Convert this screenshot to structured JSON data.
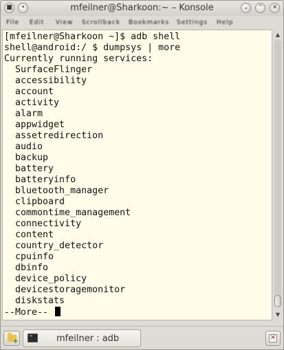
{
  "window": {
    "title": "mfeilner@Sharkoon:~ – Konsole"
  },
  "menubar": {
    "items": [
      "File",
      "Edit",
      "View",
      "Scrollback",
      "Bookmarks",
      "Settings",
      "Help"
    ]
  },
  "terminal": {
    "lines": [
      "[mfeilner@Sharkoon ~]$ adb shell",
      "shell@android:/ $ dumpsys | more",
      "Currently running services:",
      "  SurfaceFlinger",
      "  accessibility",
      "  account",
      "  activity",
      "  alarm",
      "  appwidget",
      "  assetredirection",
      "  audio",
      "  backup",
      "  battery",
      "  batteryinfo",
      "  bluetooth_manager",
      "  clipboard",
      "  commontime_management",
      "  connectivity",
      "  content",
      "  country_detector",
      "  cpuinfo",
      "  dbinfo",
      "  device_policy",
      "  devicestoragemonitor",
      "  diskstats"
    ],
    "prompt": "--More--"
  },
  "tabs": [
    {
      "label": "mfeilner : adb"
    }
  ],
  "icons": {
    "window_menu": "window-menu-icon",
    "keep_above": "keep-above-icon",
    "minimize": "minimize-icon",
    "maximize": "maximize-icon",
    "close": "close-icon",
    "new_tab": "folder-plus-icon",
    "tab": "terminal-icon",
    "close_tab": "close-tab-icon"
  },
  "colors": {
    "terminal_background": "#fffcea",
    "terminal_text": "#111111"
  }
}
